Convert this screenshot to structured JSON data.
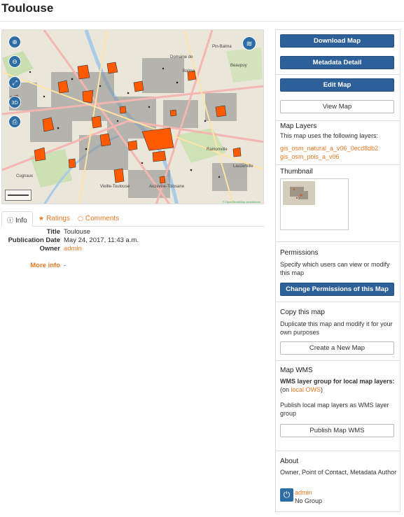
{
  "page": {
    "title": "Toulouse"
  },
  "map": {
    "zoom_in_icon": "zoom-in-icon",
    "zoom_out_icon": "zoom-out-icon",
    "fullscreen_icon": "fullscreen-icon",
    "view3d_label": "3D",
    "print_icon": "print-icon",
    "layers_icon": "layers-icon",
    "labels": {
      "domaine": "Domaine de",
      "balma": "Balma",
      "beaupuy": "Beaupuy",
      "pin_balma": "Pin-Balma",
      "ramonville": "Ramonville",
      "lauzerville": "Lauzerville",
      "vieille": "Vieille-Toulouse",
      "auzeville": "Auzeville-Tolosane",
      "cugnaux": "Cugnaux",
      "attribution": "© OpenStreetMap contributors"
    }
  },
  "tabs": [
    {
      "label": "Info",
      "icon": "info-icon"
    },
    {
      "label": "Ratings",
      "icon": "star-icon"
    },
    {
      "label": "Comments",
      "icon": "comment-icon"
    }
  ],
  "info": {
    "title_key": "Title",
    "title_val": "Toulouse",
    "date_key": "Publication Date",
    "date_val": "May 24, 2017, 11:43 a.m.",
    "owner_key": "Owner",
    "owner_val": "admin",
    "more_key": "More info",
    "more_val": "-"
  },
  "sidebar": {
    "download_map": "Download Map",
    "metadata_detail": "Metadata Detail",
    "edit_map": "Edit Map",
    "view_map": "View Map",
    "map_layers_title": "Map Layers",
    "map_layers_text": "This map uses the following layers:",
    "layers": [
      "gis_osm_natural_a_v06_0ecd8db2",
      "gis_osm_pois_a_v06"
    ],
    "thumbnail_title": "Thumbnail",
    "permissions_title": "Permissions",
    "permissions_text": "Specify which users can view or modify this map",
    "change_permissions": "Change Permissions of this Map",
    "copy_title": "Copy this map",
    "copy_text": "Duplicate this map and modify it for your own purposes",
    "create_new_map": "Create a New Map",
    "wms_title": "Map WMS",
    "wms_bold": "WMS layer group for local map layers:",
    "wms_on": "(on ",
    "wms_link": "local OWS",
    "wms_close": ")",
    "wms_publish_text": "Publish local map layers as WMS layer group",
    "publish_wms": "Publish Map WMS",
    "about_title": "About",
    "about_roles": "Owner, Point of Contact, Metadata Author",
    "about_user": "admin",
    "about_group": "No Group"
  },
  "colors": {
    "accent": "#e87722",
    "primary": "#2d5f99",
    "map_poly": "#ff5a00"
  }
}
